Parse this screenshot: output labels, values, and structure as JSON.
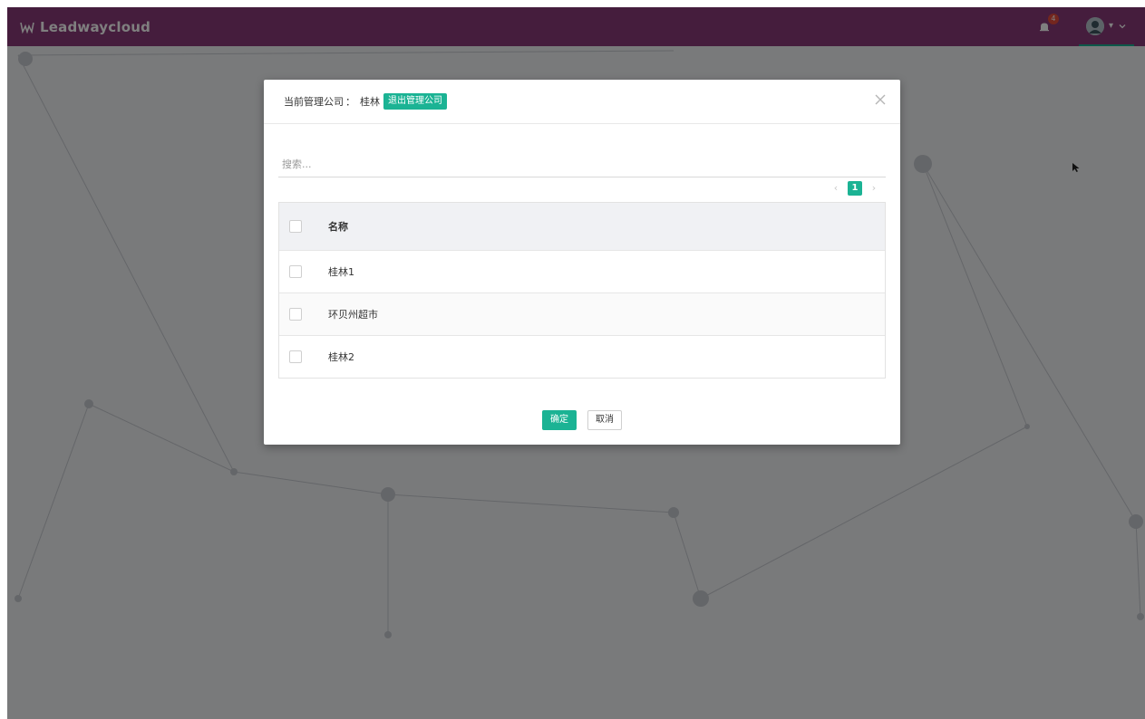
{
  "topbar": {
    "brand_name": "Leadwaycloud",
    "notification_count": "4",
    "user_name": "▾"
  },
  "modal": {
    "title_label": "当前管理公司",
    "title_separator": "：",
    "title_company": "桂林",
    "switch_button": "退出管理公司",
    "search_placeholder": "搜索...",
    "pagination": {
      "prev": "‹",
      "current": "1",
      "next": "›"
    },
    "table": {
      "header": "名称",
      "rows": [
        {
          "name": "桂林1"
        },
        {
          "name": "环贝州超市"
        },
        {
          "name": "桂林2"
        }
      ]
    },
    "confirm_button": "确定",
    "cancel_button": "取消"
  },
  "colors": {
    "topbar": "#8a3a7a",
    "accent": "#1bb394",
    "overlay": "rgba(0,0,0,0.5)"
  }
}
